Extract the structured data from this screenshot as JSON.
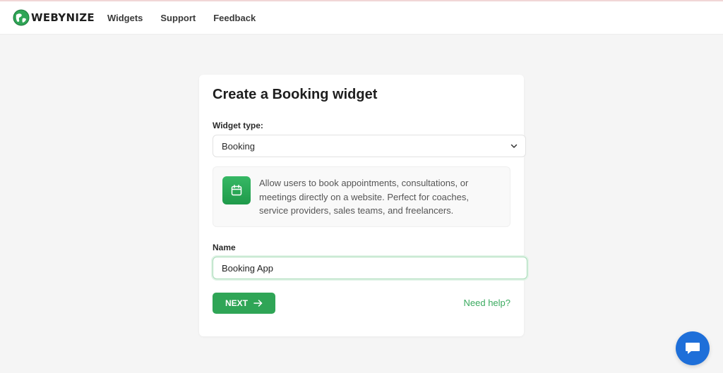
{
  "header": {
    "brand": "WEBYNIZE",
    "nav": [
      "Widgets",
      "Support",
      "Feedback"
    ]
  },
  "form": {
    "title": "Create a Booking widget",
    "widget_type_label": "Widget type:",
    "widget_type_value": "Booking",
    "description": "Allow users to book appointments, consultations, or meetings directly on a website. Perfect for coaches, service providers, sales teams, and freelancers.",
    "name_label": "Name",
    "name_value": "Booking App",
    "next_label": "NEXT",
    "help_link": "Need help?"
  },
  "icons": {
    "logo": "webynize-globe-logo",
    "select": "chevron-down-icon",
    "info": "calendar-icon",
    "next": "arrow-right-icon",
    "chat": "chat-bubble-icon"
  },
  "colors": {
    "accent": "#2fa556",
    "link": "#3aaa5f",
    "chat": "#1e6fd9"
  }
}
